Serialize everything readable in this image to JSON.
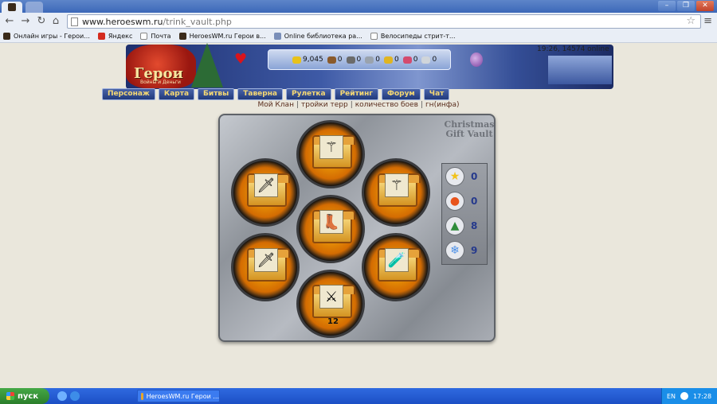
{
  "browser": {
    "url_host": "www.heroeswm.ru",
    "url_path": "/trink_vault.php",
    "bookmarks": [
      {
        "label": "Онлайн игры - Герои...",
        "color": "#3a2a1a"
      },
      {
        "label": "Яндекс",
        "color": "#d42b1e"
      },
      {
        "label": "Почта",
        "color": "#ffffff"
      },
      {
        "label": "HeroesWM.ru Герои в...",
        "color": "#3a2a1a"
      },
      {
        "label": "Online библиотека ра...",
        "color": "#7a8fb9"
      },
      {
        "label": "Велосипеды стрит-т...",
        "color": "#ffffff"
      }
    ]
  },
  "header": {
    "logo_text": "Герои",
    "logo_sub": "Войны и Деньги",
    "time_online": "19:26, 14574 online",
    "resources": [
      {
        "value": "9,045",
        "icon": "gold-icon",
        "color": "#e8c21a"
      },
      {
        "value": "0",
        "icon": "wood-icon",
        "color": "#8a5a2b"
      },
      {
        "value": "0",
        "icon": "ore-icon",
        "color": "#6b6b6b"
      },
      {
        "value": "0",
        "icon": "mercury-icon",
        "color": "#9aa3ad"
      },
      {
        "value": "0",
        "icon": "sulfur-icon",
        "color": "#e0b521"
      },
      {
        "value": "0",
        "icon": "crystal-icon",
        "color": "#d44b6e"
      },
      {
        "value": "0",
        "icon": "gem-icon",
        "color": "#d0d5da"
      }
    ]
  },
  "nav": [
    "Персонаж",
    "Карта",
    "Битвы",
    "Таверна",
    "Рулетка",
    "Рейтинг",
    "Форум",
    "Чат"
  ],
  "sublinks": [
    "Мой Клан",
    "тройки терр",
    "количество боев",
    "гн(инфа)"
  ],
  "vault": {
    "title": "Christmas Gift Vault",
    "slots": [
      {
        "item": "arrows-icon",
        "glyph": "⚚",
        "count": ""
      },
      {
        "item": "sword-icon",
        "glyph": "🗡",
        "count": ""
      },
      {
        "item": "arrows-icon",
        "glyph": "⚚",
        "count": ""
      },
      {
        "item": "boots-icon",
        "glyph": "👢",
        "count": ""
      },
      {
        "item": "sword-icon",
        "glyph": "🗡",
        "count": ""
      },
      {
        "item": "potion-icon",
        "glyph": "🧪",
        "count": ""
      },
      {
        "item": "crossed-swords-icon",
        "glyph": "⚔",
        "count": "12"
      }
    ],
    "side_counts": [
      {
        "icon": "star-icon",
        "glyph": "★",
        "color": "#f1c21b",
        "value": "0"
      },
      {
        "icon": "bauble-icon",
        "glyph": "●",
        "color": "#e8531c",
        "value": "0"
      },
      {
        "icon": "tree-icon",
        "glyph": "▲",
        "color": "#2e8b3a",
        "value": "8"
      },
      {
        "icon": "snowflake-icon",
        "glyph": "❄",
        "color": "#4a8ee6",
        "value": "9"
      }
    ]
  },
  "taskbar": {
    "start_label": "пуск",
    "task_label": "HeroesWM.ru Герои ...",
    "lang": "EN",
    "clock": "17:28"
  }
}
